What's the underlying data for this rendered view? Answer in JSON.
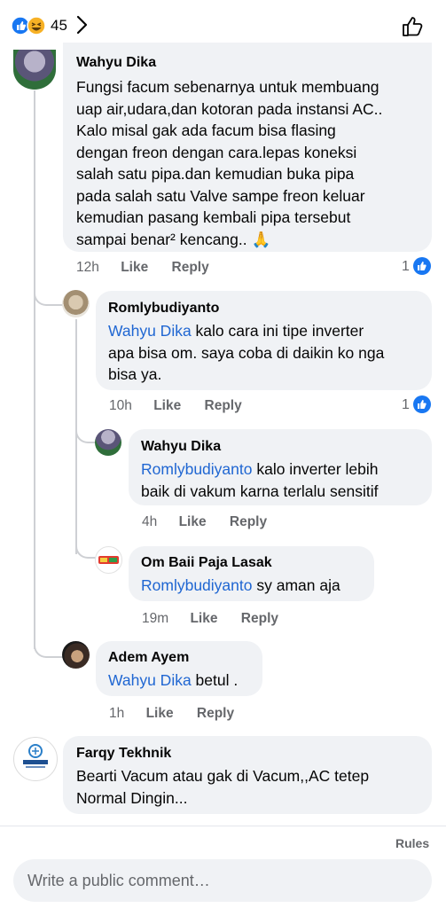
{
  "header": {
    "reaction_count": "45"
  },
  "comments": [
    {
      "name": "Wahyu Dika",
      "lines": [
        "Fungsi facum sebenarnya untuk membuang",
        "uap air,udara,dan kotoran pada instansi AC..",
        "Kalo misal gak ada facum bisa flasing",
        "dengan freon dengan cara.lepas koneksi",
        "salah satu pipa.dan kemudian buka pipa",
        "pada salah satu Valve sampe freon keluar",
        "kemudian pasang kembali pipa tersebut",
        "sampai benar² kencang.. 🙏"
      ],
      "time": "12h",
      "like": "Like",
      "reply": "Reply",
      "like_count": "1"
    },
    {
      "name": "Romlybudiyanto",
      "mention": "Wahyu Dika",
      "line1_rest": " kalo cara ini tipe inverter",
      "lines": [
        "apa bisa om. saya coba di daikin ko nga",
        "bisa ya."
      ],
      "time": "10h",
      "like": "Like",
      "reply": "Reply",
      "like_count": "1"
    },
    {
      "name": "Wahyu Dika",
      "mention": "Romlybudiyanto",
      "line1_rest": " kalo inverter lebih",
      "lines": [
        "baik di vakum karna terlalu sensitif"
      ],
      "time": "4h",
      "like": "Like",
      "reply": "Reply"
    },
    {
      "name": "Om Baii Paja Lasak",
      "mention": "Romlybudiyanto",
      "line1_rest": " sy aman aja",
      "time": "19m",
      "like": "Like",
      "reply": "Reply"
    },
    {
      "name": "Adem Ayem",
      "mention": "Wahyu Dika",
      "line1_rest": " betul .",
      "time": "1h",
      "like": "Like",
      "reply": "Reply"
    },
    {
      "name": "Farqy Tekhnik",
      "lines": [
        "Bearti Vacum atau gak di Vacum,,AC tetep",
        "Normal Dingin..."
      ]
    }
  ],
  "footer": {
    "rules": "Rules",
    "composer_placeholder": "Write a public comment…"
  },
  "colors": {
    "mention": "#1f66d2",
    "like_blue": "#1877f2",
    "bubble": "#f0f2f5",
    "meta": "#65676b"
  },
  "icons": [
    "like-reaction-icon",
    "haha-reaction-icon",
    "chevron-right-icon",
    "thumbs-up-icon",
    "praying-hands-emoji"
  ]
}
